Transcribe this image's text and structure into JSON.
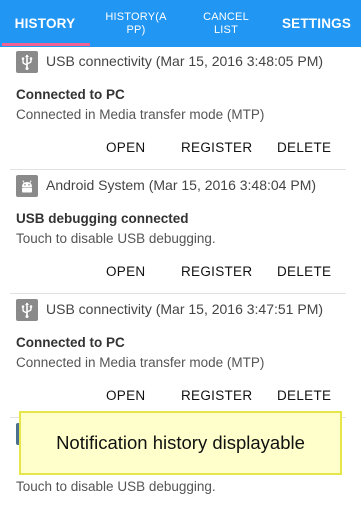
{
  "tabs": [
    {
      "label": "HISTORY"
    },
    {
      "label": "HISTORY(APP)",
      "line1": "HISTORY(A",
      "line2": "PP)"
    },
    {
      "label": "CANCEL LIST",
      "line1": "CANCEL",
      "line2": "LIST"
    },
    {
      "label": "SETTINGS"
    }
  ],
  "notifications": [
    {
      "app_icon": "usb-icon",
      "header": "USB connectivity (Mar 15, 2016 3:48:05 PM)",
      "title": "Connected to PC",
      "text": "Connected in Media transfer mode (MTP)",
      "actions": [
        "OPEN",
        "REGISTER",
        "DELETE"
      ]
    },
    {
      "app_icon": "android-icon",
      "header": "Android System (Mar 15, 2016 3:48:04 PM)",
      "title": "USB debugging connected",
      "text": "Touch to disable USB debugging.",
      "actions": [
        "OPEN",
        "REGISTER",
        "DELETE"
      ]
    },
    {
      "app_icon": "usb-icon",
      "header": "USB connectivity (Mar 15, 2016 3:47:51 PM)",
      "title": "Connected to PC",
      "text": "Connected in Media transfer mode (MTP)",
      "actions": [
        "OPEN",
        "REGISTER",
        "DELETE"
      ]
    },
    {
      "text": "Touch to disable USB debugging."
    }
  ],
  "toast": {
    "text": "Notification history displayable"
  },
  "colors": {
    "tabbar": "#2196F3",
    "tab_indicator": "#F06292",
    "toast_background": "#FFFFCC"
  }
}
